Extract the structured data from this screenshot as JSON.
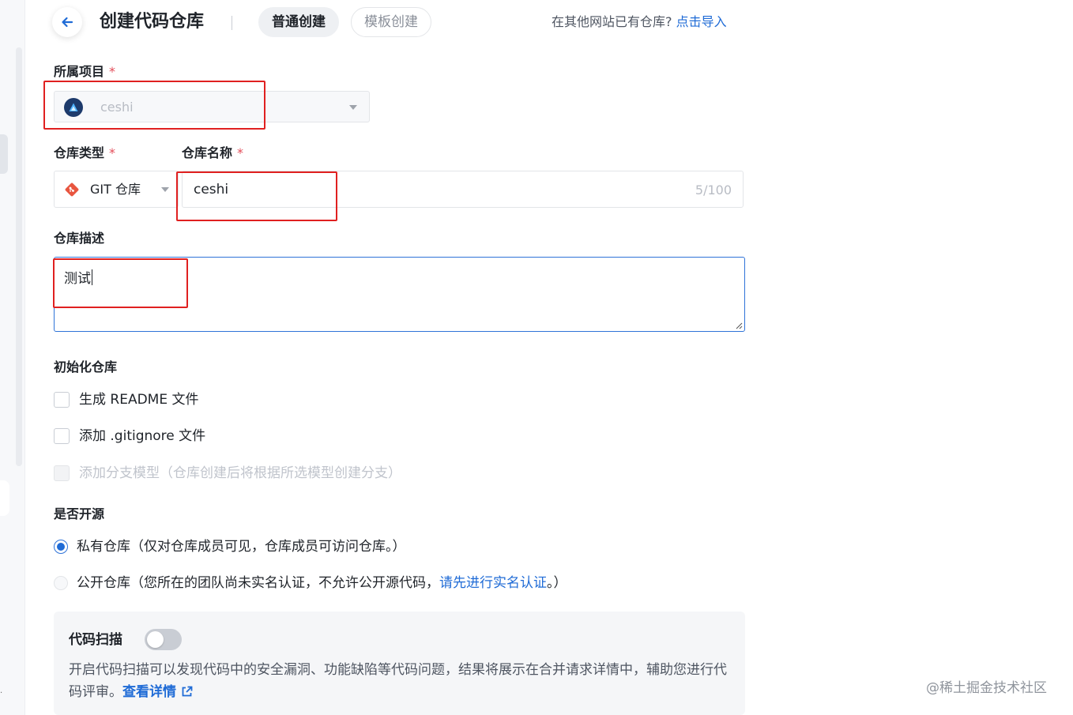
{
  "header": {
    "title": "创建代码仓库",
    "tabs": [
      {
        "label": "普通创建",
        "active": true
      },
      {
        "label": "模板创建",
        "active": false
      }
    ],
    "import_prompt": "在其他网站已有仓库?",
    "import_link": "点击导入",
    "back_icon": "arrow-left-icon"
  },
  "form": {
    "project": {
      "label": "所属项目",
      "required_mark": "*",
      "value": "ceshi"
    },
    "repo_type": {
      "label": "仓库类型",
      "required_mark": "*",
      "value": "GIT 仓库"
    },
    "repo_name": {
      "label": "仓库名称",
      "required_mark": "*",
      "value": "ceshi",
      "counter": "5/100"
    },
    "description": {
      "label": "仓库描述",
      "value": "测试"
    },
    "init": {
      "label": "初始化仓库",
      "options": [
        {
          "label": "生成 README 文件",
          "checked": false,
          "disabled": false
        },
        {
          "label": "添加 .gitignore 文件",
          "checked": false,
          "disabled": false
        },
        {
          "label": "添加分支模型（仓库创建后将根据所选模型创建分支）",
          "checked": false,
          "disabled": true
        }
      ]
    },
    "open_source": {
      "label": "是否开源",
      "private": {
        "label": "私有仓库（仅对仓库成员可见，仓库成员可访问仓库。）",
        "selected": true
      },
      "public": {
        "label_before": "公开仓库（您所在的团队尚未实名认证，不允许公开源代码，",
        "link": "请先进行实名认证",
        "label_after": "。）",
        "selected": false
      }
    },
    "code_scan": {
      "title": "代码扫描",
      "enabled": false,
      "description": "开启代码扫描可以发现代码中的安全漏洞、功能缺陷等代码问题，结果将展示在合并请求详情中，辅助您进行代码评审。",
      "link": "查看详情"
    }
  },
  "watermark": "@稀土掘金技术社区",
  "colors": {
    "primary": "#1f6bd6",
    "required": "#e34d59",
    "annotation": "#e02020"
  }
}
